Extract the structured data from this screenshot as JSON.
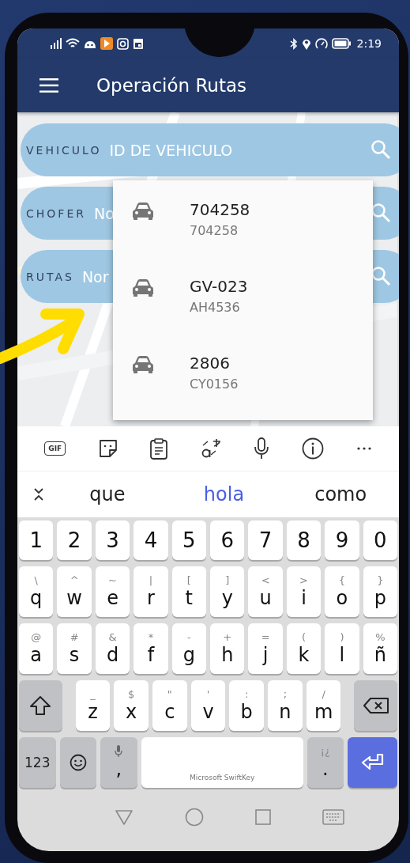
{
  "status_bar": {
    "time": "2:19"
  },
  "app_bar": {
    "title": "Operación Rutas"
  },
  "search_fields": [
    {
      "label": "VEHICULO",
      "placeholder": "ID DE VEHICULO"
    },
    {
      "label": "CHOFER",
      "placeholder": "No"
    },
    {
      "label": "RUTAS",
      "placeholder": "Nor"
    }
  ],
  "dropdown": {
    "items": [
      {
        "title": "704258",
        "subtitle": "704258"
      },
      {
        "title": "GV-023",
        "subtitle": "AH4536"
      },
      {
        "title": "2806",
        "subtitle": "CY0156"
      }
    ]
  },
  "keyboard": {
    "toolbar": {
      "gif_label": "GIF"
    },
    "suggestions": [
      {
        "text": "que",
        "selected": false
      },
      {
        "text": "hola",
        "selected": true
      },
      {
        "text": "como",
        "selected": false
      }
    ],
    "rows": [
      {
        "keys": [
          {
            "kind": "char",
            "main": "1"
          },
          {
            "kind": "char",
            "main": "2"
          },
          {
            "kind": "char",
            "main": "3"
          },
          {
            "kind": "char",
            "main": "4"
          },
          {
            "kind": "char",
            "main": "5"
          },
          {
            "kind": "char",
            "main": "6"
          },
          {
            "kind": "char",
            "main": "7"
          },
          {
            "kind": "char",
            "main": "8"
          },
          {
            "kind": "char",
            "main": "9"
          },
          {
            "kind": "char",
            "main": "0"
          }
        ]
      },
      {
        "keys": [
          {
            "kind": "char",
            "main": "q",
            "alt": "\\"
          },
          {
            "kind": "char",
            "main": "w",
            "alt": "^"
          },
          {
            "kind": "char",
            "main": "e",
            "alt": "~"
          },
          {
            "kind": "char",
            "main": "r",
            "alt": "|"
          },
          {
            "kind": "char",
            "main": "t",
            "alt": "["
          },
          {
            "kind": "char",
            "main": "y",
            "alt": "]"
          },
          {
            "kind": "char",
            "main": "u",
            "alt": "<"
          },
          {
            "kind": "char",
            "main": "i",
            "alt": ">"
          },
          {
            "kind": "char",
            "main": "o",
            "alt": "{"
          },
          {
            "kind": "char",
            "main": "p",
            "alt": "}"
          }
        ]
      },
      {
        "keys": [
          {
            "kind": "char",
            "main": "a",
            "alt": "@"
          },
          {
            "kind": "char",
            "main": "s",
            "alt": "#"
          },
          {
            "kind": "char",
            "main": "d",
            "alt": "&"
          },
          {
            "kind": "char",
            "main": "f",
            "alt": "*"
          },
          {
            "kind": "char",
            "main": "g",
            "alt": "-"
          },
          {
            "kind": "char",
            "main": "h",
            "alt": "+"
          },
          {
            "kind": "char",
            "main": "j",
            "alt": "="
          },
          {
            "kind": "char",
            "main": "k",
            "alt": "("
          },
          {
            "kind": "char",
            "main": "l",
            "alt": ")"
          },
          {
            "kind": "char",
            "main": "ñ",
            "alt": "%"
          }
        ]
      },
      {
        "keys": [
          {
            "kind": "shift"
          },
          {
            "kind": "char",
            "main": "z",
            "alt": "_"
          },
          {
            "kind": "char",
            "main": "x",
            "alt": "$"
          },
          {
            "kind": "char",
            "main": "c",
            "alt": "\""
          },
          {
            "kind": "char",
            "main": "v",
            "alt": "'"
          },
          {
            "kind": "char",
            "main": "b",
            "alt": ":"
          },
          {
            "kind": "char",
            "main": "n",
            "alt": ";"
          },
          {
            "kind": "char",
            "main": "m",
            "alt": "/"
          },
          {
            "kind": "backspace"
          }
        ]
      },
      {
        "keys": [
          {
            "kind": "mode",
            "main": "123"
          },
          {
            "kind": "emoji"
          },
          {
            "kind": "comma",
            "main": ","
          },
          {
            "kind": "space",
            "main": "Microsoft SwiftKey"
          },
          {
            "kind": "period",
            "main": ".",
            "alt": "¡¿"
          },
          {
            "kind": "enter"
          }
        ]
      }
    ]
  }
}
